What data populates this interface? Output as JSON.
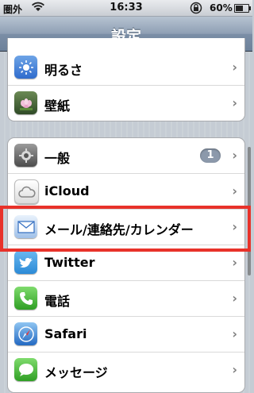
{
  "status": {
    "carrier": "圏外",
    "time": "16:33",
    "battery": "60%",
    "battery_level": 0.6
  },
  "nav": {
    "title": "設定"
  },
  "group1": [
    {
      "label": "明るさ",
      "icon": "brightness-icon"
    },
    {
      "label": "壁紙",
      "icon": "wallpaper-icon"
    }
  ],
  "group2": [
    {
      "label": "一般",
      "icon": "gear-icon",
      "badge": "1"
    },
    {
      "label": "iCloud",
      "icon": "cloud-icon"
    },
    {
      "label": "メール/連絡先/カレンダー",
      "icon": "mail-icon"
    },
    {
      "label": "Twitter",
      "icon": "twitter-bird-icon"
    },
    {
      "label": "電話",
      "icon": "phone-icon"
    },
    {
      "label": "Safari",
      "icon": "compass-icon"
    },
    {
      "label": "メッセージ",
      "icon": "message-bubble-icon"
    }
  ],
  "colors": {
    "highlight": "#e8322a",
    "nav": "#7b8ea6"
  }
}
